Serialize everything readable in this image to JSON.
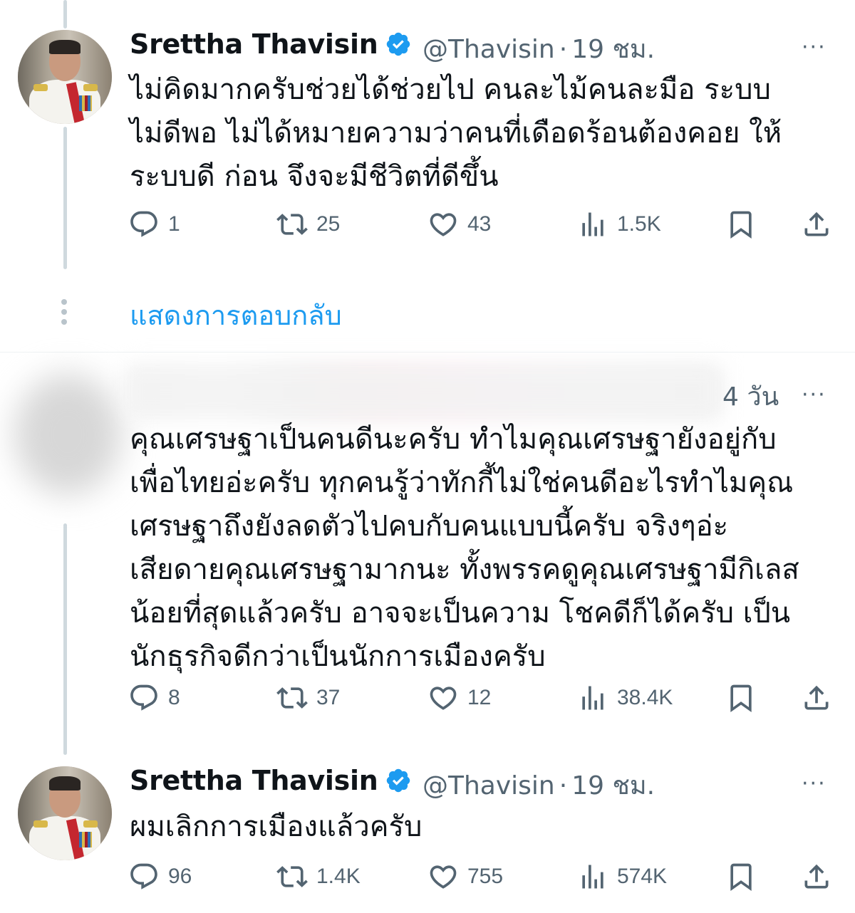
{
  "tweets": [
    {
      "display_name": "Srettha Thavisin",
      "handle": "@Thavisin",
      "separator": "·",
      "time": "19 ชม.",
      "more": "···",
      "text": "ไม่คิดมากครับช่วยได้ช่วยไป คนละไม้คนละมือ ระบบ\nไม่ดีพอ ไม่ได้หมายความว่าคนที่เดือดร้อนต้องคอย ให้\nระบบดี ก่อน จึงจะมีชีวิตที่ดีขึ้น",
      "replies": "1",
      "reposts": "25",
      "likes": "43",
      "views": "1.5K"
    },
    {
      "time": "4 วัน",
      "more": "···",
      "text": "คุณเศรษฐาเป็นคนดีนะครับ ทำไมคุณเศรษฐายังอยู่กับ\nเพื่อไทยอ่ะครับ ทุกคนรู้ว่าทักกี้ไม่ใช่คนดีอะไรทำไมคุณ\nเศรษฐาถึงยังลดตัวไปคบกับคนแบบนี้ครับ จริงๆอ่ะ\nเสียดายคุณเศรษฐามากนะ ทั้งพรรคดูคุณเศรษฐามีกิเลส\nน้อยที่สุดแล้วครับ อาจจะเป็นความ โชคดีก็ได้ครับ เป็น\nนักธุรกิจดีกว่าเป็นนักการเมืองครับ",
      "replies": "8",
      "reposts": "37",
      "likes": "12",
      "views": "38.4K"
    },
    {
      "display_name": "Srettha Thavisin",
      "handle": "@Thavisin",
      "separator": "·",
      "time": "19 ชม.",
      "more": "···",
      "text": "ผมเลิกการเมืองแล้วครับ",
      "replies": "96",
      "reposts": "1.4K",
      "likes": "755",
      "views": "574K"
    }
  ],
  "show_replies": "แสดงการตอบกลับ",
  "colors": {
    "link": "#1d9bf0",
    "verified": "#1d9bf0",
    "muted": "#536471",
    "thread_line": "#cfd9de"
  },
  "icons": [
    "reply-icon",
    "repost-icon",
    "like-icon",
    "views-icon",
    "bookmark-icon",
    "share-icon",
    "verified-badge-icon",
    "more-icon"
  ]
}
